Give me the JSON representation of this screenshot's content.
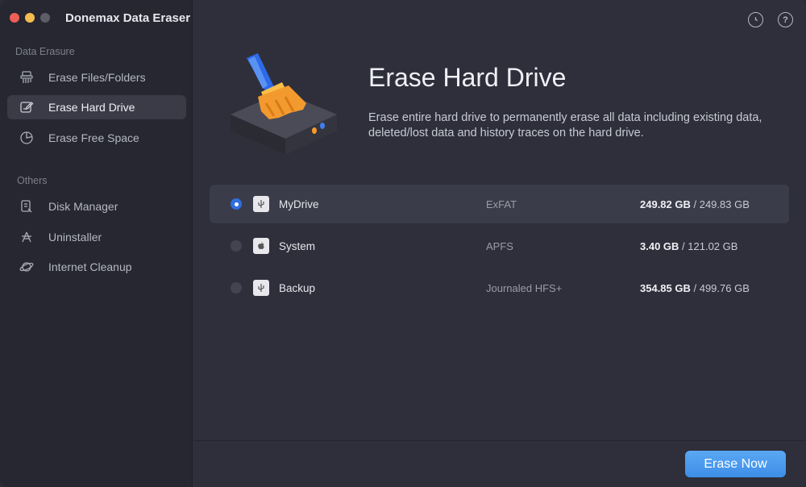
{
  "app": {
    "title": "Donemax Data Eraser"
  },
  "sidebar": {
    "sections": [
      {
        "label": "Data Erasure"
      },
      {
        "label": "Others"
      }
    ],
    "items": [
      {
        "label": "Erase Files/Folders",
        "icon": "shredder-icon"
      },
      {
        "label": "Erase Hard Drive",
        "icon": "edit-drive-icon"
      },
      {
        "label": "Erase Free Space",
        "icon": "pie-icon"
      },
      {
        "label": "Disk Manager",
        "icon": "disk-manager-icon"
      },
      {
        "label": "Uninstaller",
        "icon": "uninstaller-icon"
      },
      {
        "label": "Internet Cleanup",
        "icon": "planet-icon"
      }
    ]
  },
  "header": {
    "history_icon": "clock-icon",
    "help_icon": "help-icon",
    "help_glyph": "?"
  },
  "main": {
    "title": "Erase Hard Drive",
    "description": "Erase entire hard drive to permanently erase all data including existing data, deleted/lost data and history traces on the hard drive.",
    "drives": [
      {
        "name": "MyDrive",
        "fs": "ExFAT",
        "used": "249.82 GB",
        "sep": " / ",
        "total": "249.83 GB",
        "type": "usb",
        "selected": true
      },
      {
        "name": "System",
        "fs": "APFS",
        "used": "3.40 GB",
        "sep": " / ",
        "total": "121.02 GB",
        "type": "apple",
        "selected": false
      },
      {
        "name": "Backup",
        "fs": "Journaled HFS+",
        "used": "354.85 GB",
        "sep": " / ",
        "total": "499.76 GB",
        "type": "usb",
        "selected": false
      }
    ],
    "erase_button": "Erase Now"
  },
  "colors": {
    "accent": "#3d8ee8",
    "radio_on": "#2f6fe0",
    "sidebar_bg": "#262730",
    "main_bg": "#2e2f3b"
  }
}
